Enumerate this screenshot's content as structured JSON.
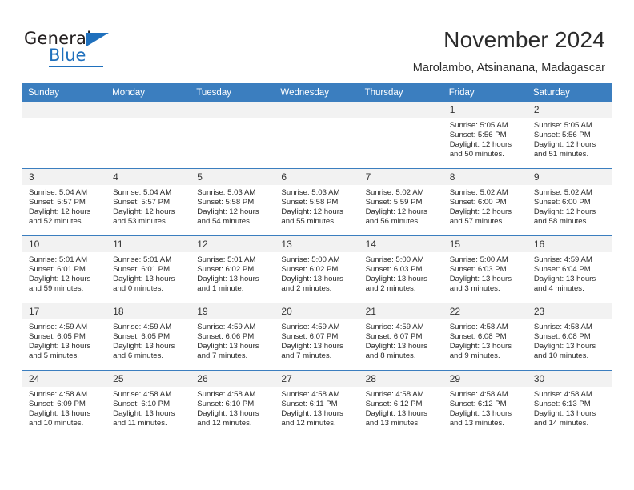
{
  "brand": {
    "word_one": "General",
    "word_two": "Blue",
    "triangle_icon": "blue-triangle-icon",
    "accent_color": "#1f70bd"
  },
  "header": {
    "title": "November 2024",
    "subtitle": "Marolambo, Atsinanana, Madagascar"
  },
  "calendar": {
    "header_bg": "#3b7ebf",
    "daynum_bg": "#f2f2f2",
    "weekdays": [
      "Sunday",
      "Monday",
      "Tuesday",
      "Wednesday",
      "Thursday",
      "Friday",
      "Saturday"
    ],
    "weeks": [
      [
        {
          "day": "",
          "empty": true
        },
        {
          "day": "",
          "empty": true
        },
        {
          "day": "",
          "empty": true
        },
        {
          "day": "",
          "empty": true
        },
        {
          "day": "",
          "empty": true
        },
        {
          "day": "1",
          "sunrise": "Sunrise: 5:05 AM",
          "sunset": "Sunset: 5:56 PM",
          "daylight": "Daylight: 12 hours and 50 minutes."
        },
        {
          "day": "2",
          "sunrise": "Sunrise: 5:05 AM",
          "sunset": "Sunset: 5:56 PM",
          "daylight": "Daylight: 12 hours and 51 minutes."
        }
      ],
      [
        {
          "day": "3",
          "sunrise": "Sunrise: 5:04 AM",
          "sunset": "Sunset: 5:57 PM",
          "daylight": "Daylight: 12 hours and 52 minutes."
        },
        {
          "day": "4",
          "sunrise": "Sunrise: 5:04 AM",
          "sunset": "Sunset: 5:57 PM",
          "daylight": "Daylight: 12 hours and 53 minutes."
        },
        {
          "day": "5",
          "sunrise": "Sunrise: 5:03 AM",
          "sunset": "Sunset: 5:58 PM",
          "daylight": "Daylight: 12 hours and 54 minutes."
        },
        {
          "day": "6",
          "sunrise": "Sunrise: 5:03 AM",
          "sunset": "Sunset: 5:58 PM",
          "daylight": "Daylight: 12 hours and 55 minutes."
        },
        {
          "day": "7",
          "sunrise": "Sunrise: 5:02 AM",
          "sunset": "Sunset: 5:59 PM",
          "daylight": "Daylight: 12 hours and 56 minutes."
        },
        {
          "day": "8",
          "sunrise": "Sunrise: 5:02 AM",
          "sunset": "Sunset: 6:00 PM",
          "daylight": "Daylight: 12 hours and 57 minutes."
        },
        {
          "day": "9",
          "sunrise": "Sunrise: 5:02 AM",
          "sunset": "Sunset: 6:00 PM",
          "daylight": "Daylight: 12 hours and 58 minutes."
        }
      ],
      [
        {
          "day": "10",
          "sunrise": "Sunrise: 5:01 AM",
          "sunset": "Sunset: 6:01 PM",
          "daylight": "Daylight: 12 hours and 59 minutes."
        },
        {
          "day": "11",
          "sunrise": "Sunrise: 5:01 AM",
          "sunset": "Sunset: 6:01 PM",
          "daylight": "Daylight: 13 hours and 0 minutes."
        },
        {
          "day": "12",
          "sunrise": "Sunrise: 5:01 AM",
          "sunset": "Sunset: 6:02 PM",
          "daylight": "Daylight: 13 hours and 1 minute."
        },
        {
          "day": "13",
          "sunrise": "Sunrise: 5:00 AM",
          "sunset": "Sunset: 6:02 PM",
          "daylight": "Daylight: 13 hours and 2 minutes."
        },
        {
          "day": "14",
          "sunrise": "Sunrise: 5:00 AM",
          "sunset": "Sunset: 6:03 PM",
          "daylight": "Daylight: 13 hours and 2 minutes."
        },
        {
          "day": "15",
          "sunrise": "Sunrise: 5:00 AM",
          "sunset": "Sunset: 6:03 PM",
          "daylight": "Daylight: 13 hours and 3 minutes."
        },
        {
          "day": "16",
          "sunrise": "Sunrise: 4:59 AM",
          "sunset": "Sunset: 6:04 PM",
          "daylight": "Daylight: 13 hours and 4 minutes."
        }
      ],
      [
        {
          "day": "17",
          "sunrise": "Sunrise: 4:59 AM",
          "sunset": "Sunset: 6:05 PM",
          "daylight": "Daylight: 13 hours and 5 minutes."
        },
        {
          "day": "18",
          "sunrise": "Sunrise: 4:59 AM",
          "sunset": "Sunset: 6:05 PM",
          "daylight": "Daylight: 13 hours and 6 minutes."
        },
        {
          "day": "19",
          "sunrise": "Sunrise: 4:59 AM",
          "sunset": "Sunset: 6:06 PM",
          "daylight": "Daylight: 13 hours and 7 minutes."
        },
        {
          "day": "20",
          "sunrise": "Sunrise: 4:59 AM",
          "sunset": "Sunset: 6:07 PM",
          "daylight": "Daylight: 13 hours and 7 minutes."
        },
        {
          "day": "21",
          "sunrise": "Sunrise: 4:59 AM",
          "sunset": "Sunset: 6:07 PM",
          "daylight": "Daylight: 13 hours and 8 minutes."
        },
        {
          "day": "22",
          "sunrise": "Sunrise: 4:58 AM",
          "sunset": "Sunset: 6:08 PM",
          "daylight": "Daylight: 13 hours and 9 minutes."
        },
        {
          "day": "23",
          "sunrise": "Sunrise: 4:58 AM",
          "sunset": "Sunset: 6:08 PM",
          "daylight": "Daylight: 13 hours and 10 minutes."
        }
      ],
      [
        {
          "day": "24",
          "sunrise": "Sunrise: 4:58 AM",
          "sunset": "Sunset: 6:09 PM",
          "daylight": "Daylight: 13 hours and 10 minutes."
        },
        {
          "day": "25",
          "sunrise": "Sunrise: 4:58 AM",
          "sunset": "Sunset: 6:10 PM",
          "daylight": "Daylight: 13 hours and 11 minutes."
        },
        {
          "day": "26",
          "sunrise": "Sunrise: 4:58 AM",
          "sunset": "Sunset: 6:10 PM",
          "daylight": "Daylight: 13 hours and 12 minutes."
        },
        {
          "day": "27",
          "sunrise": "Sunrise: 4:58 AM",
          "sunset": "Sunset: 6:11 PM",
          "daylight": "Daylight: 13 hours and 12 minutes."
        },
        {
          "day": "28",
          "sunrise": "Sunrise: 4:58 AM",
          "sunset": "Sunset: 6:12 PM",
          "daylight": "Daylight: 13 hours and 13 minutes."
        },
        {
          "day": "29",
          "sunrise": "Sunrise: 4:58 AM",
          "sunset": "Sunset: 6:12 PM",
          "daylight": "Daylight: 13 hours and 13 minutes."
        },
        {
          "day": "30",
          "sunrise": "Sunrise: 4:58 AM",
          "sunset": "Sunset: 6:13 PM",
          "daylight": "Daylight: 13 hours and 14 minutes."
        }
      ]
    ]
  }
}
